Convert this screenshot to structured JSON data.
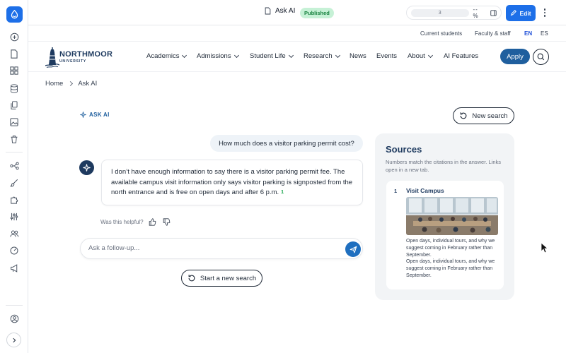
{
  "cms": {
    "doc_title": "Ask AI",
    "status_badge": "Published",
    "zoom_value": "3",
    "zoom_percent": "-- %",
    "edit_label": "Edit",
    "accent": "#1d6fe8",
    "rail_icons": [
      "plus-circle-icon",
      "page-icon",
      "grid-icon",
      "database-icon",
      "copy-icon",
      "image-icon",
      "trash-icon",
      "workflow-icon",
      "brush-icon",
      "puzzle-icon",
      "sliders-icon",
      "users-icon",
      "gauge-icon",
      "megaphone-icon",
      "user-circle-icon",
      "chevron-right-icon"
    ]
  },
  "utility": {
    "current_students": "Current students",
    "faculty_staff": "Faculty & staff",
    "lang_en": "EN",
    "lang_es": "ES"
  },
  "header": {
    "logo_name": "NORTHMOOR",
    "logo_sub": "UNIVERSITY",
    "nav": {
      "academics": "Academics",
      "admissions": "Admissions",
      "student_life": "Student Life",
      "research": "Research",
      "news": "News",
      "events": "Events",
      "about": "About",
      "ai_features": "AI Features"
    },
    "apply_label": "Apply",
    "brand_color": "#1f5f9e"
  },
  "breadcrumb": {
    "home": "Home",
    "current": "Ask AI"
  },
  "chat": {
    "label": "ASK AI",
    "new_search": "New search",
    "user_question": "How much does a visitor parking permit cost?",
    "answer_text": "I don’t have enough information to say there is a visitor parking permit fee. The available campus visit information only says visitor parking is signposted from the north entrance and is free on open days and after 6 p.m.",
    "citation": "1",
    "helpful_prompt": "Was this helpful?",
    "followup_placeholder": "Ask a follow-up...",
    "start_new_search": "Start a new search"
  },
  "sources": {
    "title": "Sources",
    "description": "Numbers match the citations in the answer. Links open in a new tab.",
    "items": [
      {
        "num": "1",
        "title": "Visit Campus",
        "snippet_1": "Open days, individual tours, and why we suggest coming in February rather than September.",
        "snippet_2": "Open days, individual tours, and why we suggest coming in February rather than September."
      }
    ]
  }
}
